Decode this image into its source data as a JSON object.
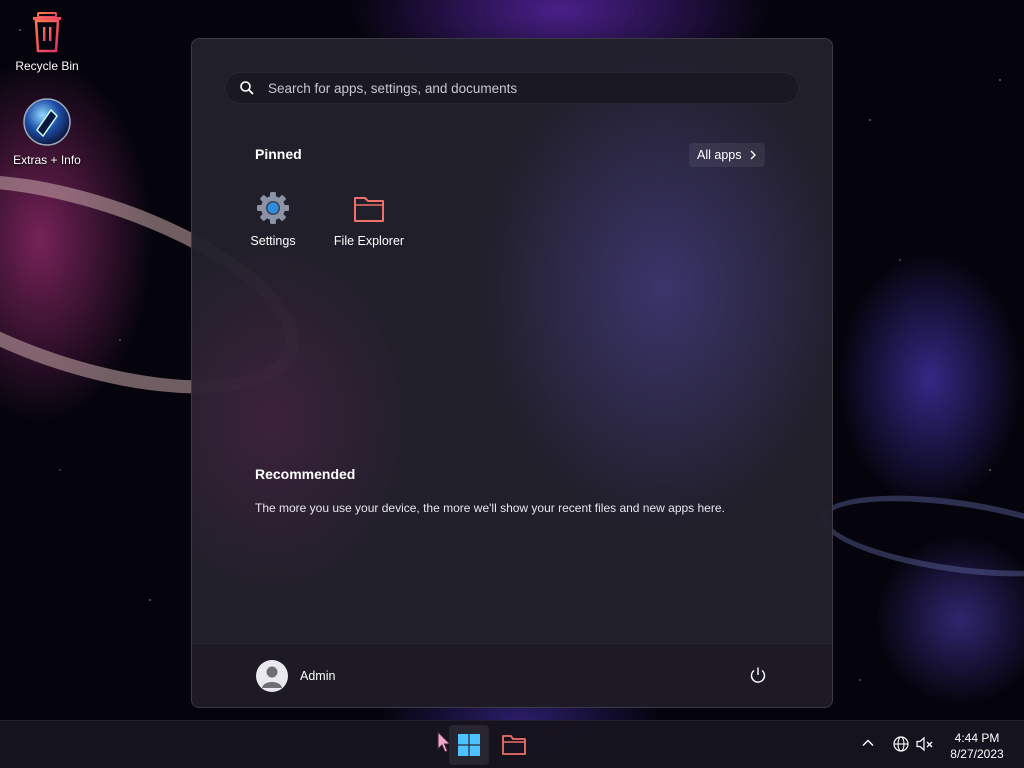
{
  "desktop": {
    "icons": [
      {
        "label": "Recycle Bin",
        "icon": "recycle-bin-icon"
      },
      {
        "label": "Extras + Info",
        "icon": "extras-info-icon"
      }
    ]
  },
  "start_menu": {
    "search": {
      "placeholder": "Search for apps, settings, and documents"
    },
    "pinned": {
      "title": "Pinned",
      "all_apps_label": "All apps",
      "apps": [
        {
          "label": "Settings",
          "icon": "settings-gear-icon"
        },
        {
          "label": "File Explorer",
          "icon": "folder-icon"
        }
      ]
    },
    "recommended": {
      "title": "Recommended",
      "message": "The more you use your device, the more we'll show your recent files and new apps here."
    },
    "user": {
      "name": "Admin"
    }
  },
  "taskbar": {
    "items": [
      "start-button",
      "file-explorer"
    ],
    "clock": {
      "time": "4:44 PM",
      "date": "8/27/2023"
    }
  },
  "colors": {
    "accent": "#4cc2ff",
    "folder": "#f0706a",
    "start_menu_bg": "#22202c"
  }
}
